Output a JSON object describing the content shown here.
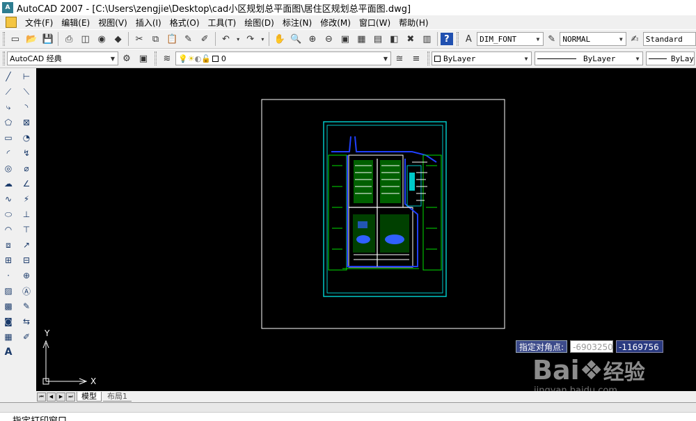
{
  "titlebar": {
    "app_icon": "A",
    "title": "AutoCAD 2007 - [C:\\Users\\zengjie\\Desktop\\cad小区规划总平面图\\居住区规划总平面图.dwg]"
  },
  "menu": {
    "items": [
      "文件(F)",
      "编辑(E)",
      "视图(V)",
      "插入(I)",
      "格式(O)",
      "工具(T)",
      "绘图(D)",
      "标注(N)",
      "修改(M)",
      "窗口(W)",
      "帮助(H)"
    ]
  },
  "toolbar1": {
    "dim_style": "DIM_FONT",
    "plot_style": "NORMAL",
    "text_style": "Standard"
  },
  "toolbar2": {
    "workspace": "AutoCAD 经典",
    "layer": "0",
    "color": "ByLayer",
    "linetype": "ByLayer",
    "lineweight": "ByLay"
  },
  "canvas": {
    "ucs_x": "X",
    "ucs_y": "Y",
    "coord_label": "指定对角点:",
    "coord_x": "-6903250",
    "coord_y": "-1169756",
    "colors": {
      "background": "#000000",
      "frame": "#ffffff",
      "border": "#00c8c8",
      "green": "#00e000",
      "blue": "#2040ff"
    }
  },
  "tabs": {
    "model": "模型",
    "layout": "布局1"
  },
  "command": {
    "prompt": "指定打印窗口"
  },
  "watermark": {
    "logo_text": "Bai",
    "logo_cn": "经验",
    "url": "jingyan.baidu.com"
  }
}
